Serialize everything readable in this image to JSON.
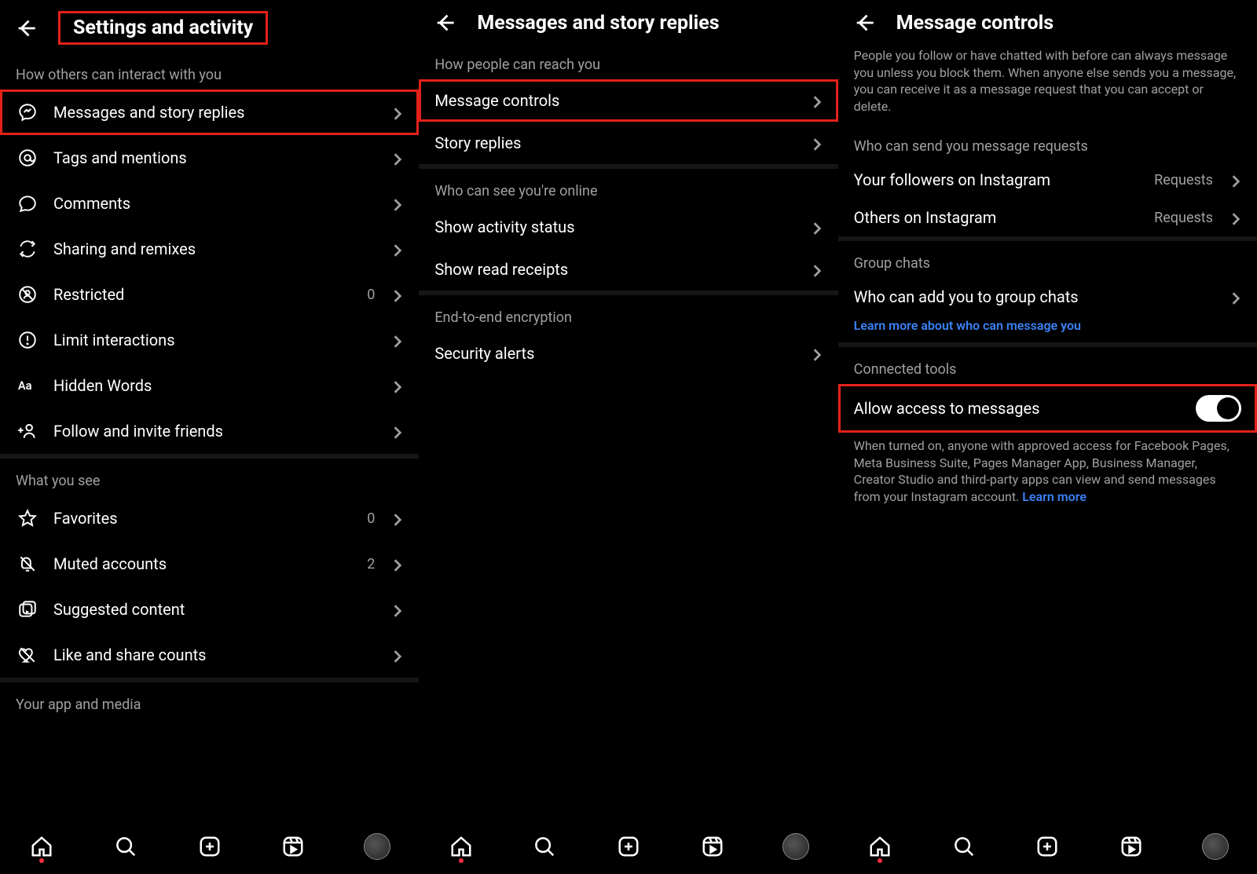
{
  "panel1": {
    "title": "Settings and activity",
    "section1_label": "How others can interact with you",
    "items1": [
      {
        "label": "Messages and story replies"
      },
      {
        "label": "Tags and mentions"
      },
      {
        "label": "Comments"
      },
      {
        "label": "Sharing and remixes"
      },
      {
        "label": "Restricted",
        "value": "0"
      },
      {
        "label": "Limit interactions"
      },
      {
        "label": "Hidden Words"
      },
      {
        "label": "Follow and invite friends"
      }
    ],
    "section2_label": "What you see",
    "items2": [
      {
        "label": "Favorites",
        "value": "0"
      },
      {
        "label": "Muted accounts",
        "value": "2"
      },
      {
        "label": "Suggested content"
      },
      {
        "label": "Like and share counts"
      }
    ],
    "section3_label": "Your app and media"
  },
  "panel2": {
    "title": "Messages and story replies",
    "section1_label": "How people can reach you",
    "items1": [
      {
        "label": "Message controls"
      },
      {
        "label": "Story replies"
      }
    ],
    "section2_label": "Who can see you're online",
    "items2": [
      {
        "label": "Show activity status"
      },
      {
        "label": "Show read receipts"
      }
    ],
    "section3_label": "End-to-end encryption",
    "items3": [
      {
        "label": "Security alerts"
      }
    ]
  },
  "panel3": {
    "title": "Message controls",
    "intro": "People you follow or have chatted with before can always message you unless you block them. When anyone else sends you a message, you can receive it as a message request that you can accept or delete.",
    "section1_label": "Who can send you message requests",
    "items1": [
      {
        "label": "Your followers on Instagram",
        "value": "Requests"
      },
      {
        "label": "Others on Instagram",
        "value": "Requests"
      }
    ],
    "section2_label": "Group chats",
    "items2": [
      {
        "label": "Who can add you to group chats"
      }
    ],
    "learn_link": "Learn more about who can message you",
    "section3_label": "Connected tools",
    "toggle_label": "Allow access to messages",
    "toggle_note": "When turned on, anyone with approved access for Facebook Pages, Meta Business Suite, Pages Manager App, Business Manager, Creator Studio and third-party apps can view and send messages from your Instagram account. ",
    "learn_more": "Learn more"
  }
}
